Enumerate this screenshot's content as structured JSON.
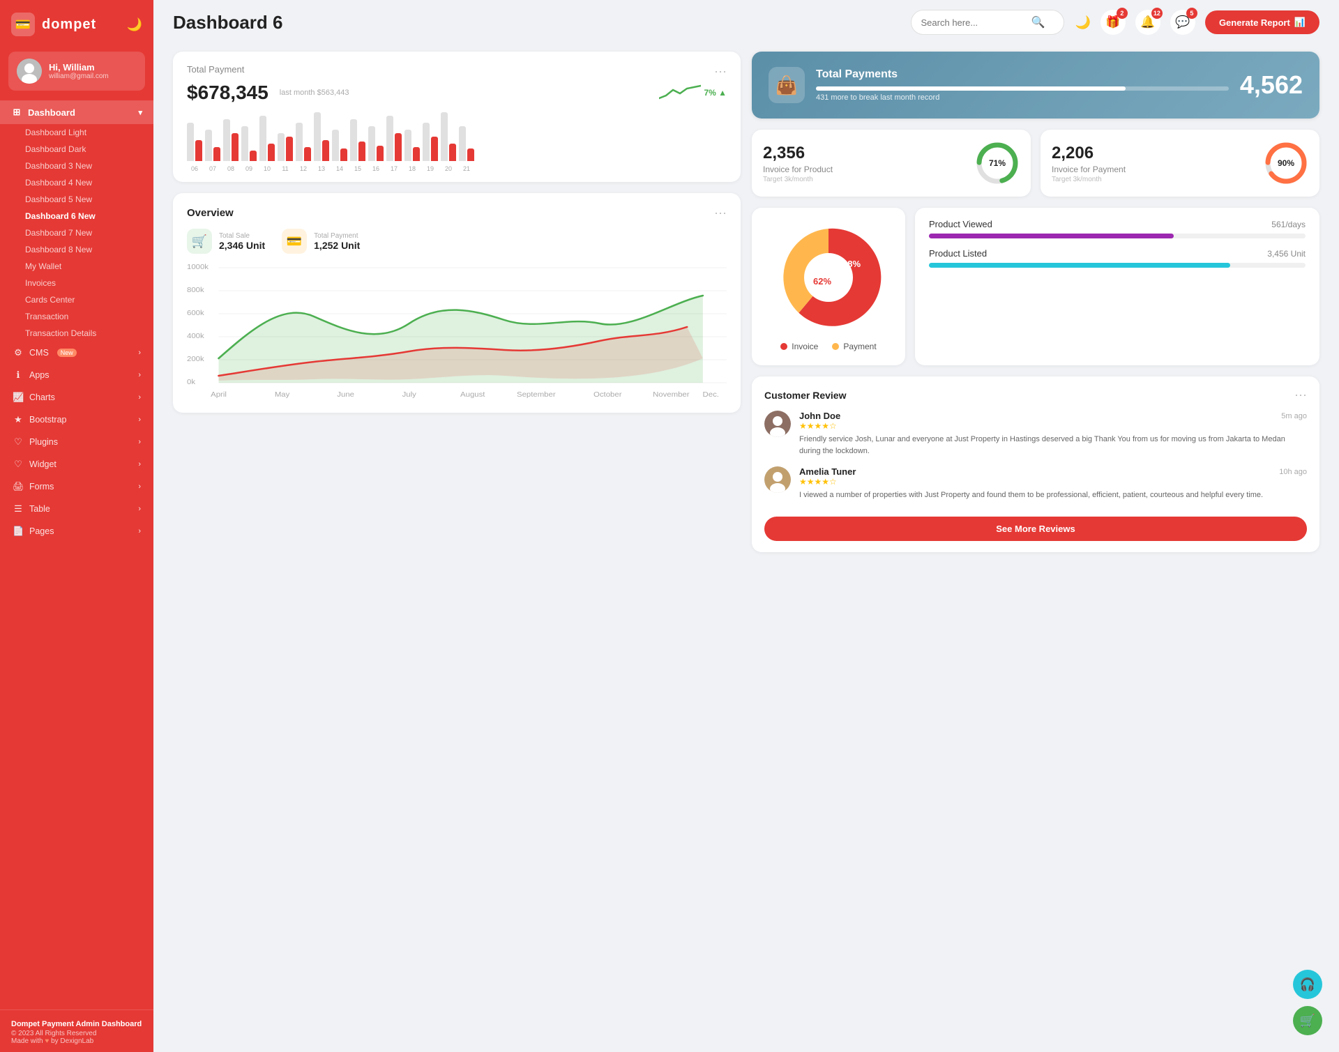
{
  "sidebar": {
    "logo_text": "dompet",
    "hamburger": "☰",
    "user": {
      "greeting": "Hi, William",
      "email": "william@gmail.com"
    },
    "nav": {
      "dashboard_label": "Dashboard",
      "items": [
        {
          "label": "Dashboard Light",
          "sub": true
        },
        {
          "label": "Dashboard Dark",
          "sub": true
        },
        {
          "label": "Dashboard 3",
          "sub": true,
          "badge": "New"
        },
        {
          "label": "Dashboard 4",
          "sub": true,
          "badge": "New"
        },
        {
          "label": "Dashboard 5",
          "sub": true,
          "badge": "New"
        },
        {
          "label": "Dashboard 6",
          "sub": true,
          "badge": "New",
          "active": true
        },
        {
          "label": "Dashboard 7",
          "sub": true,
          "badge": "New"
        },
        {
          "label": "Dashboard 8",
          "sub": true,
          "badge": "New"
        },
        {
          "label": "My Wallet",
          "sub": true
        },
        {
          "label": "Invoices",
          "sub": true
        },
        {
          "label": "Cards Center",
          "sub": true
        },
        {
          "label": "Transaction",
          "sub": true
        },
        {
          "label": "Transaction Details",
          "sub": true
        }
      ],
      "sections": [
        {
          "label": "CMS",
          "badge": "New",
          "has_arrow": true
        },
        {
          "label": "Apps",
          "has_arrow": true
        },
        {
          "label": "Charts",
          "has_arrow": true
        },
        {
          "label": "Bootstrap",
          "has_arrow": true
        },
        {
          "label": "Plugins",
          "has_arrow": true
        },
        {
          "label": "Widget",
          "has_arrow": true
        },
        {
          "label": "Forms",
          "has_arrow": true
        },
        {
          "label": "Table",
          "has_arrow": true
        },
        {
          "label": "Pages",
          "has_arrow": true
        }
      ]
    },
    "footer": {
      "title": "Dompet Payment Admin Dashboard",
      "copy": "© 2023 All Rights Reserved",
      "made_with": "Made with",
      "by": "by DexignLab"
    }
  },
  "topbar": {
    "title": "Dashboard 6",
    "search_placeholder": "Search here...",
    "icons": {
      "moon": "🌙",
      "gift_badge": "2",
      "bell_badge": "12",
      "chat_badge": "5"
    },
    "generate_btn": "Generate Report"
  },
  "total_payment": {
    "title": "Total Payment",
    "amount": "$678,345",
    "last_month": "last month $563,443",
    "trend": "7%",
    "more_label": "···",
    "bars": [
      {
        "month": "06",
        "gray": 55,
        "red": 30
      },
      {
        "month": "07",
        "gray": 45,
        "red": 20
      },
      {
        "month": "08",
        "gray": 60,
        "red": 40
      },
      {
        "month": "09",
        "gray": 50,
        "red": 15
      },
      {
        "month": "10",
        "gray": 65,
        "red": 25
      },
      {
        "month": "11",
        "gray": 40,
        "red": 35
      },
      {
        "month": "12",
        "gray": 55,
        "red": 20
      },
      {
        "month": "13",
        "gray": 70,
        "red": 30
      },
      {
        "month": "14",
        "gray": 45,
        "red": 18
      },
      {
        "month": "15",
        "gray": 60,
        "red": 28
      },
      {
        "month": "16",
        "gray": 50,
        "red": 22
      },
      {
        "month": "17",
        "gray": 65,
        "red": 40
      },
      {
        "month": "18",
        "gray": 45,
        "red": 20
      },
      {
        "month": "19",
        "gray": 55,
        "red": 35
      },
      {
        "month": "20",
        "gray": 70,
        "red": 25
      },
      {
        "month": "21",
        "gray": 50,
        "red": 18
      }
    ]
  },
  "blue_card": {
    "title": "Total Payments",
    "sub": "431 more to break last month record",
    "number": "4,562",
    "progress": 75
  },
  "invoice_product": {
    "number": "2,356",
    "label": "Invoice for Product",
    "target": "Target 3k/month",
    "pct": "71%",
    "pct_num": 71
  },
  "invoice_payment": {
    "number": "2,206",
    "label": "Invoice for Payment",
    "target": "Target 3k/month",
    "pct": "90%",
    "pct_num": 90
  },
  "overview": {
    "title": "Overview",
    "more_label": "···",
    "total_sale_label": "Total Sale",
    "total_sale_value": "2,346 Unit",
    "total_payment_label": "Total Payment",
    "total_payment_value": "1,252 Unit",
    "months": [
      "April",
      "May",
      "June",
      "July",
      "August",
      "September",
      "October",
      "November",
      "Dec."
    ],
    "y_labels": [
      "1000k",
      "800k",
      "600k",
      "400k",
      "200k",
      "0k"
    ]
  },
  "pie_chart": {
    "invoice_pct": 62,
    "payment_pct": 38,
    "invoice_label": "Invoice",
    "payment_label": "Payment",
    "invoice_color": "#e53935",
    "payment_color": "#ffb74d"
  },
  "products": {
    "viewed_label": "Product Viewed",
    "viewed_value": "561/days",
    "viewed_pct": 65,
    "viewed_color": "#9c27b0",
    "listed_label": "Product Listed",
    "listed_value": "3,456 Unit",
    "listed_pct": 80,
    "listed_color": "#26c6da"
  },
  "reviews": {
    "title": "Customer Review",
    "more_label": "···",
    "items": [
      {
        "name": "John Doe",
        "time": "5m ago",
        "stars": 4,
        "text": "Friendly service Josh, Lunar and everyone at Just Property in Hastings deserved a big Thank You from us for moving us from Jakarta to Medan during the lockdown."
      },
      {
        "name": "Amelia Tuner",
        "time": "10h ago",
        "stars": 4,
        "text": "I viewed a number of properties with Just Property and found them to be professional, efficient, patient, courteous and helpful every time."
      }
    ],
    "see_more_btn": "See More Reviews"
  },
  "fab": {
    "headset": "🎧",
    "cart": "🛒"
  }
}
